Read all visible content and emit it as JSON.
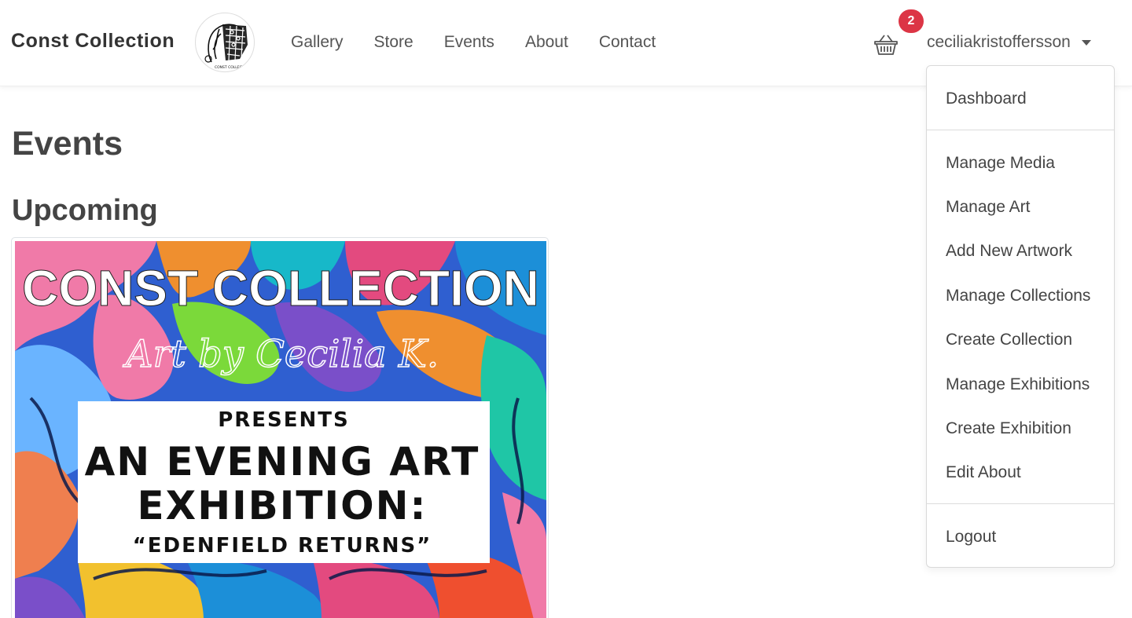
{
  "navbar": {
    "brand": "Const Collection",
    "logo_text": "CONST COLLECTION",
    "links": [
      "Gallery",
      "Store",
      "Events",
      "About",
      "Contact"
    ],
    "cart_count": "2",
    "username": "ceciliakristoffersson"
  },
  "main": {
    "title": "Events",
    "section": "Upcoming",
    "poster": {
      "heading": "CONST COLLECTION",
      "script": "Art by Cecilia K.",
      "presents": "PRESENTS",
      "line1": "AN EVENING ART",
      "line2": "EXHIBITION:",
      "subtitle": "“EDENFIELD RETURNS”"
    }
  },
  "dropdown": {
    "dashboard": "Dashboard",
    "manage_media": "Manage Media",
    "manage_art": "Manage Art",
    "add_artwork": "Add New Artwork",
    "manage_collections": "Manage Collections",
    "create_collection": "Create Collection",
    "manage_exhibitions": "Manage Exhibitions",
    "create_exhibition": "Create Exhibition",
    "edit_about": "Edit About",
    "logout": "Logout"
  },
  "colors": {
    "badge": "#dc3545",
    "text": "#555555",
    "heading": "#444444"
  }
}
